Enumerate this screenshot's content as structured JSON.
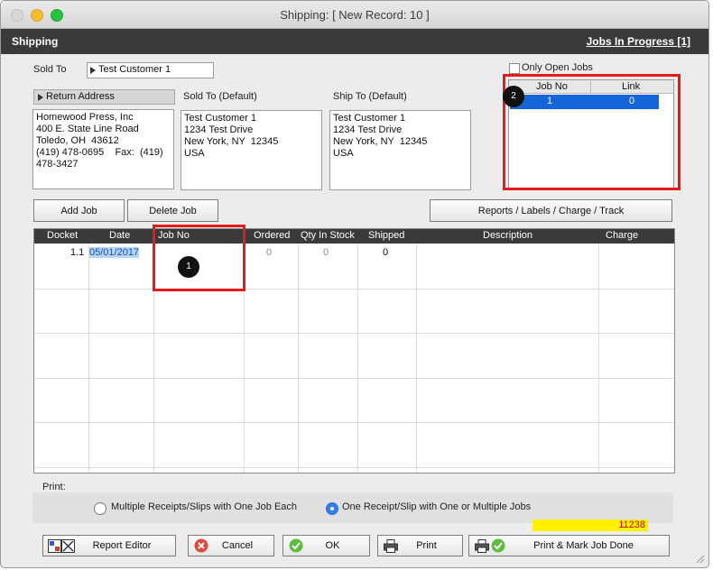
{
  "window": {
    "title": "Shipping:  [ New Record: 10 ]"
  },
  "header": {
    "title": "Shipping",
    "jobs_in_progress": "Jobs In Progress [1]"
  },
  "sold_to": {
    "label": "Sold To",
    "value": "Test Customer 1"
  },
  "only_open_jobs": {
    "label": "Only Open Jobs",
    "checked": false
  },
  "addresses": {
    "return_label": "Return Address",
    "return_text": "Homewood Press, Inc\n400 E. State Line Road\nToledo, OH  43612\n(419) 478-0695    Fax:  (419)\n478-3427",
    "sold_to_label": "Sold To (Default)",
    "sold_to_text": "Test Customer 1\n1234 Test Drive\nNew York, NY  12345\nUSA",
    "ship_to_label": "Ship To (Default)",
    "ship_to_text": "Test Customer 1\n1234 Test Drive\nNew York, NY  12345\nUSA"
  },
  "jobs_list": {
    "columns": [
      "Job No",
      "Link"
    ],
    "rows": [
      {
        "job_no": "1",
        "link": "0"
      }
    ]
  },
  "buttons": {
    "add_job": "Add Job",
    "delete_job": "Delete Job",
    "reports": "Reports / Labels / Charge / Track",
    "report_editor": "Report Editor",
    "cancel": "Cancel",
    "ok": "OK",
    "print": "Print",
    "print_mark_done": "Print  &  Mark Job Done"
  },
  "grid": {
    "columns": [
      "Docket",
      "Date",
      "Job No",
      "Ordered",
      "Qty In Stock",
      "Shipped",
      "Description",
      "Charge"
    ],
    "rows": [
      {
        "docket": "1.1",
        "date": "05/01/2017",
        "job_no": "",
        "ordered": "0",
        "qty_in_stock": "0",
        "shipped": "0",
        "description": "",
        "charge": ""
      }
    ]
  },
  "callouts": {
    "one": "1",
    "two": "2"
  },
  "print": {
    "label": "Print:",
    "option_multiple": "Multiple Receipts/Slips with One Job Each",
    "option_one": "One Receipt/Slip with One or Multiple Jobs",
    "selected": "one"
  },
  "record_number": "11238",
  "colors": {
    "highlight": "#1565d8",
    "callout_red": "#e41b1b",
    "record_bg": "#fff200"
  }
}
